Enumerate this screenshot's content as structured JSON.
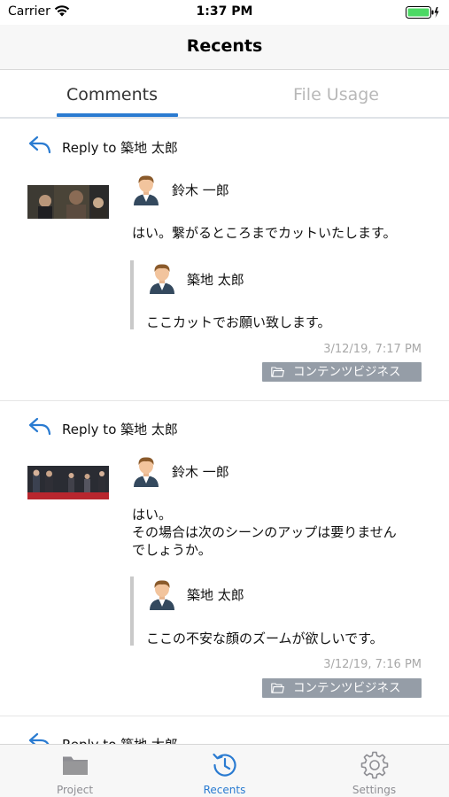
{
  "status_bar": {
    "carrier": "Carrier",
    "time": "1:37 PM"
  },
  "nav": {
    "title": "Recents"
  },
  "tabs": {
    "comments": "Comments",
    "file_usage": "File Usage"
  },
  "comments": [
    {
      "reply_to": "Reply to 築地 太郎",
      "author": "鈴木 一郎",
      "text": "はい。繋がるところまでカットいたします。",
      "quote_author": "築地 太郎",
      "quote_text": "ここカットでお願い致します。",
      "timestamp": "3/12/19, 7:17 PM",
      "folder": "コンテンツビジネス"
    },
    {
      "reply_to": "Reply to 築地 太郎",
      "author": "鈴木 一郎",
      "text": "はい。\nその場合は次のシーンのアップは要りません\nでしょうか。",
      "quote_author": "築地 太郎",
      "quote_text": "ここの不安な顔のズームが欲しいです。",
      "timestamp": "3/12/19, 7:16 PM",
      "folder": "コンテンツビジネス"
    },
    {
      "reply_to": "Reply to 築地 太郎"
    }
  ],
  "tab_bar": {
    "items": [
      {
        "label": "Project",
        "icon": "folder-icon"
      },
      {
        "label": "Recents",
        "icon": "recents-icon"
      },
      {
        "label": "Settings",
        "icon": "gear-icon"
      }
    ],
    "active_color": "#2a7bd1",
    "inactive_color": "#8e8e93"
  },
  "colors": {
    "accent": "#2a7bd1",
    "folder_badge": "#959da7",
    "timestamp": "#a8a8a8"
  }
}
